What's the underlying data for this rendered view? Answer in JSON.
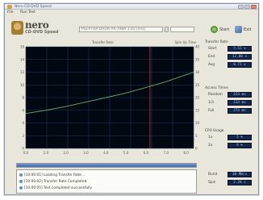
{
  "window": {
    "title": "Nero CD-DVD Speed"
  },
  "menu": [
    "File",
    "Run Test"
  ],
  "logo": {
    "word": "nero",
    "subtitle": "CD-DVD Speed"
  },
  "toolbar": {
    "drive_select": "PLEXTOR DVDR PX-708A 1.02 [0:0]",
    "start_label": "Start",
    "exit_label": "Exit"
  },
  "chart": {
    "header_left": "Transfer Rate",
    "header_right": "Spin Up Time"
  },
  "panels": {
    "transfer_rate": {
      "title": "Transfer Rate",
      "rows": [
        {
          "label": "Start",
          "value": "5.52 x"
        },
        {
          "label": "End",
          "value": "12.00 x"
        },
        {
          "label": "Avg",
          "value": "8.72 x"
        }
      ]
    },
    "access_times": {
      "title": "Access Times",
      "rows": [
        {
          "label": "Random",
          "value": "153 ms"
        },
        {
          "label": "1/3",
          "value": "133 ms"
        },
        {
          "label": "Full",
          "value": "274 ms"
        }
      ]
    },
    "cpu_usage": {
      "title": "CPU Usage",
      "rows": [
        {
          "label": "1x",
          "value": "5 %"
        },
        {
          "label": "2x",
          "value": "9 %"
        }
      ]
    },
    "burst_rate": {
      "title": "Burst Rate",
      "rows": [
        {
          "label": "Burst",
          "value": "30 MB/s"
        },
        {
          "label": "Spin",
          "value": "2.28 s"
        }
      ]
    }
  },
  "progress": {
    "value": 1.0
  },
  "log": [
    "[10:00:01] Loading Transfer Rate...",
    "[10:00:02] Transfer Rate Completed",
    "[10:00:05] Test completed successfully"
  ],
  "chart_data": {
    "type": "line",
    "x": [
      0,
      8.38
    ],
    "xlim": [
      0,
      8.38
    ],
    "ylim_left": [
      0,
      16
    ],
    "ylim_right": [
      0,
      40
    ],
    "grid": true,
    "series": [
      {
        "x": [
          0,
          1,
          2,
          3,
          4,
          5,
          6,
          7,
          8,
          8.38
        ],
        "y": [
          5.5,
          6.0,
          6.6,
          7.3,
          8.0,
          8.7,
          9.6,
          10.5,
          11.6,
          12.0
        ]
      }
    ],
    "markers": [
      {
        "x": 6.2,
        "color": "#c0392b"
      }
    ],
    "colors": {
      "background": "#020812",
      "grid": "#1d3a5a",
      "line": "#6ba86a",
      "marker": "#c0392b"
    }
  }
}
